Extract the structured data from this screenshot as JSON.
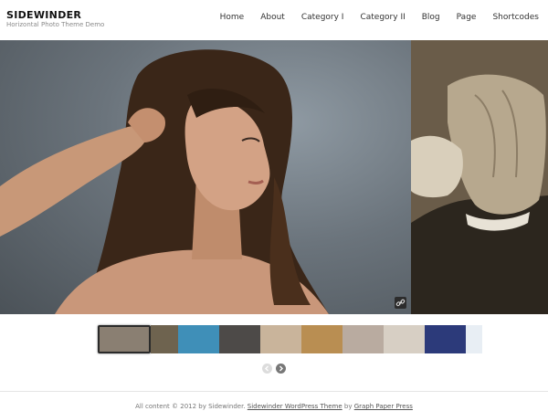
{
  "site": {
    "title": "SIDEWINDER",
    "tagline": "Horizontal Photo Theme Demo"
  },
  "nav": {
    "items": [
      "Home",
      "About",
      "Category I",
      "Category II",
      "Blog",
      "Page",
      "Shortcodes"
    ]
  },
  "slider": {
    "main_slide": "portrait-woman-image",
    "side_slide": "hand-grip-image",
    "link_icon": "link-icon"
  },
  "thumbnails": [
    {
      "name": "thumb-woman-portrait",
      "color": "#8a7f72",
      "active": true
    },
    {
      "name": "thumb-hand",
      "color": "#6e634f",
      "active": false
    },
    {
      "name": "thumb-underwater",
      "color": "#3f8fb8",
      "active": false
    },
    {
      "name": "thumb-man-portrait",
      "color": "#4d4a48",
      "active": false
    },
    {
      "name": "thumb-woman-lying",
      "color": "#c9b49b",
      "active": false
    },
    {
      "name": "thumb-golden",
      "color": "#b98e52",
      "active": false
    },
    {
      "name": "thumb-old-man",
      "color": "#b9aba0",
      "active": false
    },
    {
      "name": "thumb-reading",
      "color": "#d7cfc4",
      "active": false
    },
    {
      "name": "thumb-concert",
      "color": "#2c3a7a",
      "active": false
    },
    {
      "name": "thumb-jump",
      "color": "#e8eef4",
      "active": false
    }
  ],
  "pager": {
    "prev_icon": "chevron-left-icon",
    "next_icon": "chevron-right-icon"
  },
  "footer": {
    "prefix": "All content © 2012 by Sidewinder. ",
    "theme_link": "Sidewinder WordPress Theme",
    "by": " by ",
    "author_link": "Graph Paper Press"
  }
}
